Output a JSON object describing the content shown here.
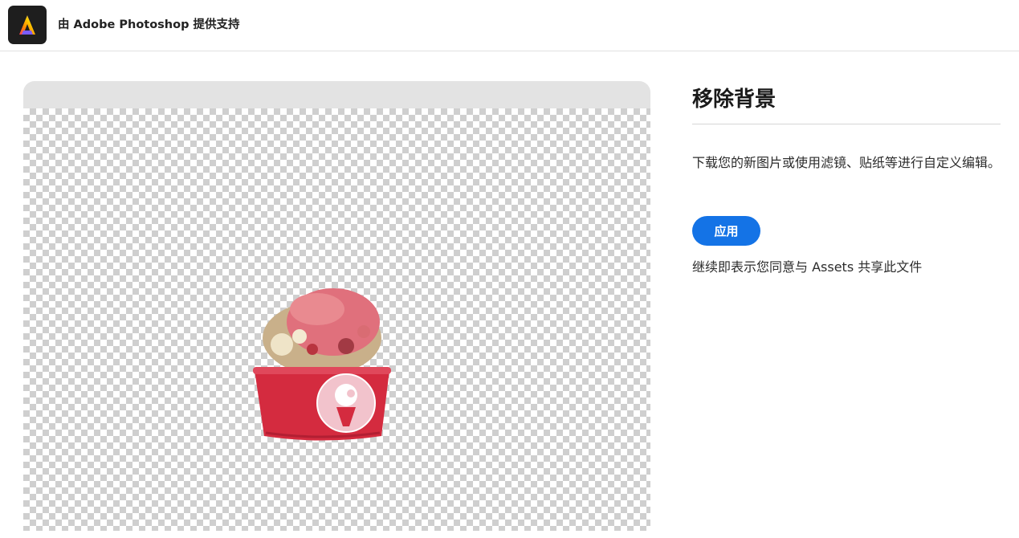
{
  "header": {
    "title": "由 Adobe Photoshop 提供支持",
    "logo_icon": "adobe-express-logo-icon"
  },
  "preview": {
    "subject": "ice-cream-cup-cutout"
  },
  "panel": {
    "title": "移除背景",
    "description": "下载您的新图片或使用滤镜、贴纸等进行自定义编辑。",
    "apply_label": "应用",
    "consent": "继续即表示您同意与 Assets 共享此文件"
  },
  "colors": {
    "accent": "#1473e6",
    "cup_red": "#d42b3f",
    "checker_gray": "#cfcfcf"
  }
}
